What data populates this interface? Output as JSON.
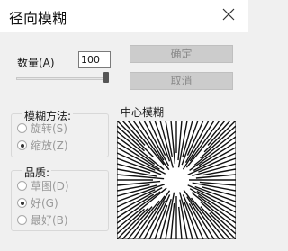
{
  "window": {
    "title": "径向模糊"
  },
  "amount": {
    "label": "数量(A)",
    "value": "100",
    "slider_fraction": 1.0
  },
  "buttons": {
    "ok": "确定",
    "cancel": "取消"
  },
  "blur_method": {
    "legend": "模糊方法:",
    "options": [
      {
        "label": "旋转(S)",
        "selected": false
      },
      {
        "label": "缩放(Z)",
        "selected": true
      }
    ]
  },
  "quality": {
    "legend": "品质:",
    "options": [
      {
        "label": "草图(D)",
        "selected": false
      },
      {
        "label": "好(G)",
        "selected": true
      },
      {
        "label": "最好(B)",
        "selected": false
      }
    ]
  },
  "center": {
    "label": "中心模糊"
  },
  "icons": {
    "close": "close-icon"
  },
  "colors": {
    "background": "#f0f0f0",
    "disabled_text": "#9a9a9a"
  }
}
